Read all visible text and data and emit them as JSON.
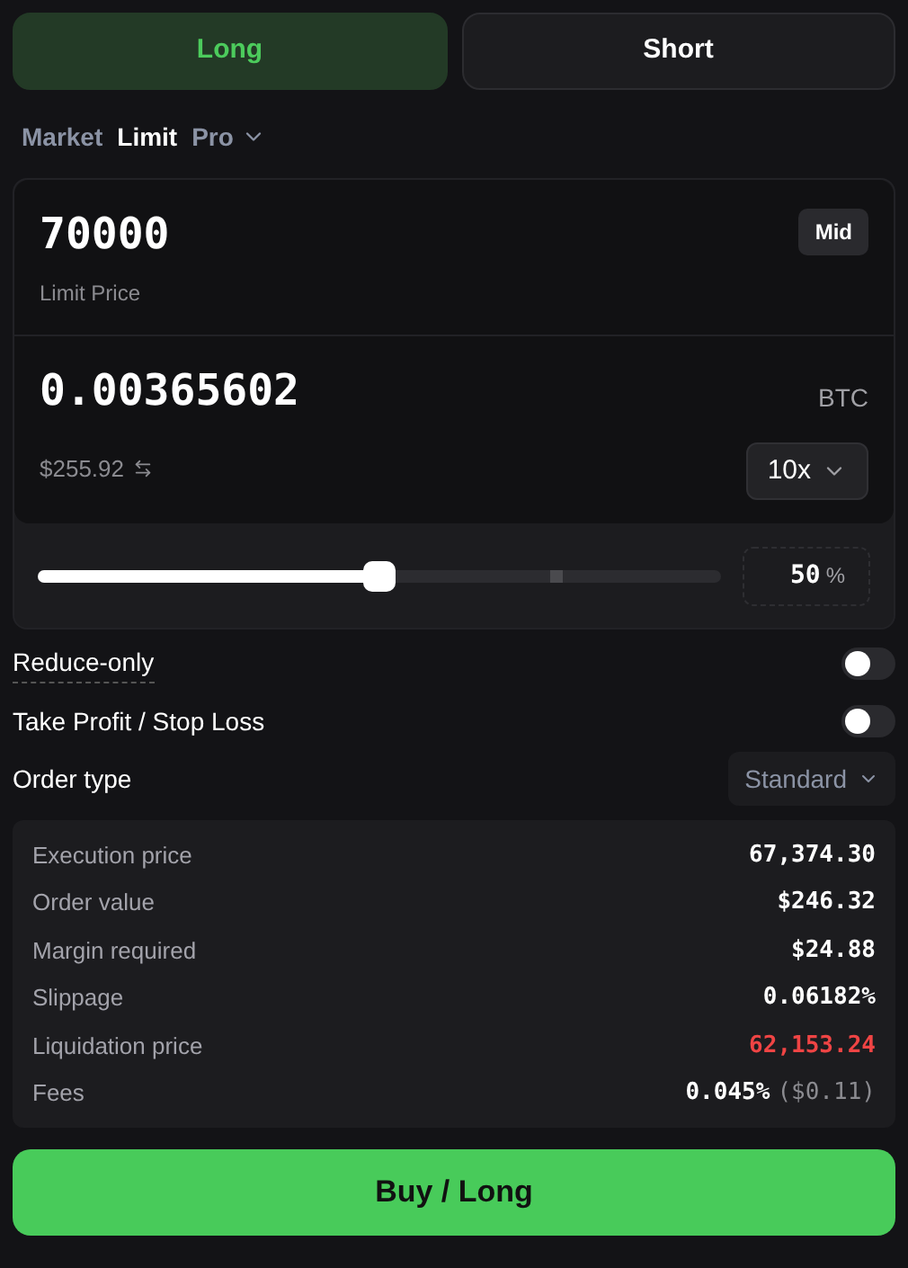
{
  "side_tabs": [
    {
      "label": "Long",
      "selected": true
    },
    {
      "label": "Short",
      "selected": false
    }
  ],
  "order_tabs": [
    {
      "label": "Market",
      "selected": false,
      "dropdown": false
    },
    {
      "label": "Limit",
      "selected": true,
      "dropdown": false
    },
    {
      "label": "Pro",
      "selected": false,
      "dropdown": true
    }
  ],
  "price": {
    "value": "70000",
    "label": "Limit Price",
    "button": "Mid"
  },
  "size": {
    "value": "0.00365602",
    "unit": "BTC",
    "usd": "$255.92",
    "leverage": "10x"
  },
  "slider": {
    "level": 0.5,
    "percent": "50",
    "unit": "%"
  },
  "toggles": [
    {
      "label": "Reduce-only",
      "on": false,
      "underlined": true
    },
    {
      "label": "Take Profit / Stop Loss",
      "on": false,
      "underlined": false
    }
  ],
  "order_type": {
    "label": "Order type",
    "value": "Standard"
  },
  "summary": [
    {
      "label": "Execution price",
      "value": "67,374.30",
      "color": "#ffffff"
    },
    {
      "label": "Order value",
      "value": "$246.32",
      "color": "#ffffff"
    },
    {
      "label": "Margin required",
      "value": "$24.88",
      "color": "#ffffff"
    },
    {
      "label": "Slippage",
      "value": "0.06182%",
      "color": "#ffffff"
    },
    {
      "label": "Liquidation price",
      "value": "62,153.24",
      "color": "#ef4444"
    },
    {
      "label": "Fees",
      "value": "0.045%",
      "extra": "($0.11)",
      "color": "#ffffff"
    }
  ],
  "submit": "Buy / Long"
}
